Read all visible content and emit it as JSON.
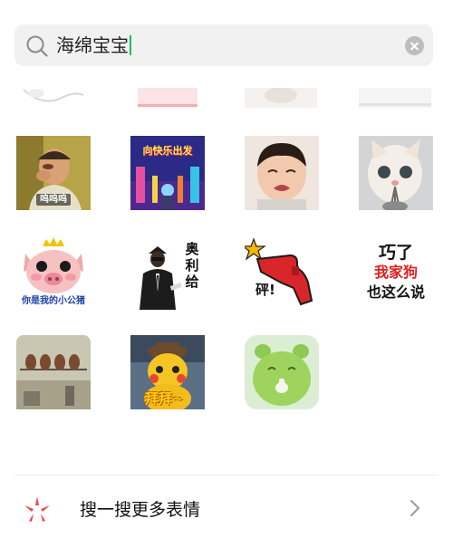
{
  "search": {
    "query": "海绵宝宝"
  },
  "stickers": {
    "wuwu_caption": "呜呜呜",
    "poster_text": "向快乐出发",
    "pig_caption": "你是我的小公猪",
    "aoligei_caption": "奥利给",
    "peng_caption": "砰!",
    "dog_lines": [
      "巧了",
      "我家狗",
      "也这么说"
    ],
    "baibai_caption": "拜拜~"
  },
  "more": {
    "label": "搜一搜更多表情"
  },
  "colors": {
    "search_bg": "#f1f1f1",
    "caret": "#07c160",
    "sparkle_red": "#f5474b",
    "dog_red": "#e02020"
  },
  "icons": [
    "search-icon",
    "clear-icon",
    "sparkle-icon",
    "chevron-right-icon"
  ]
}
